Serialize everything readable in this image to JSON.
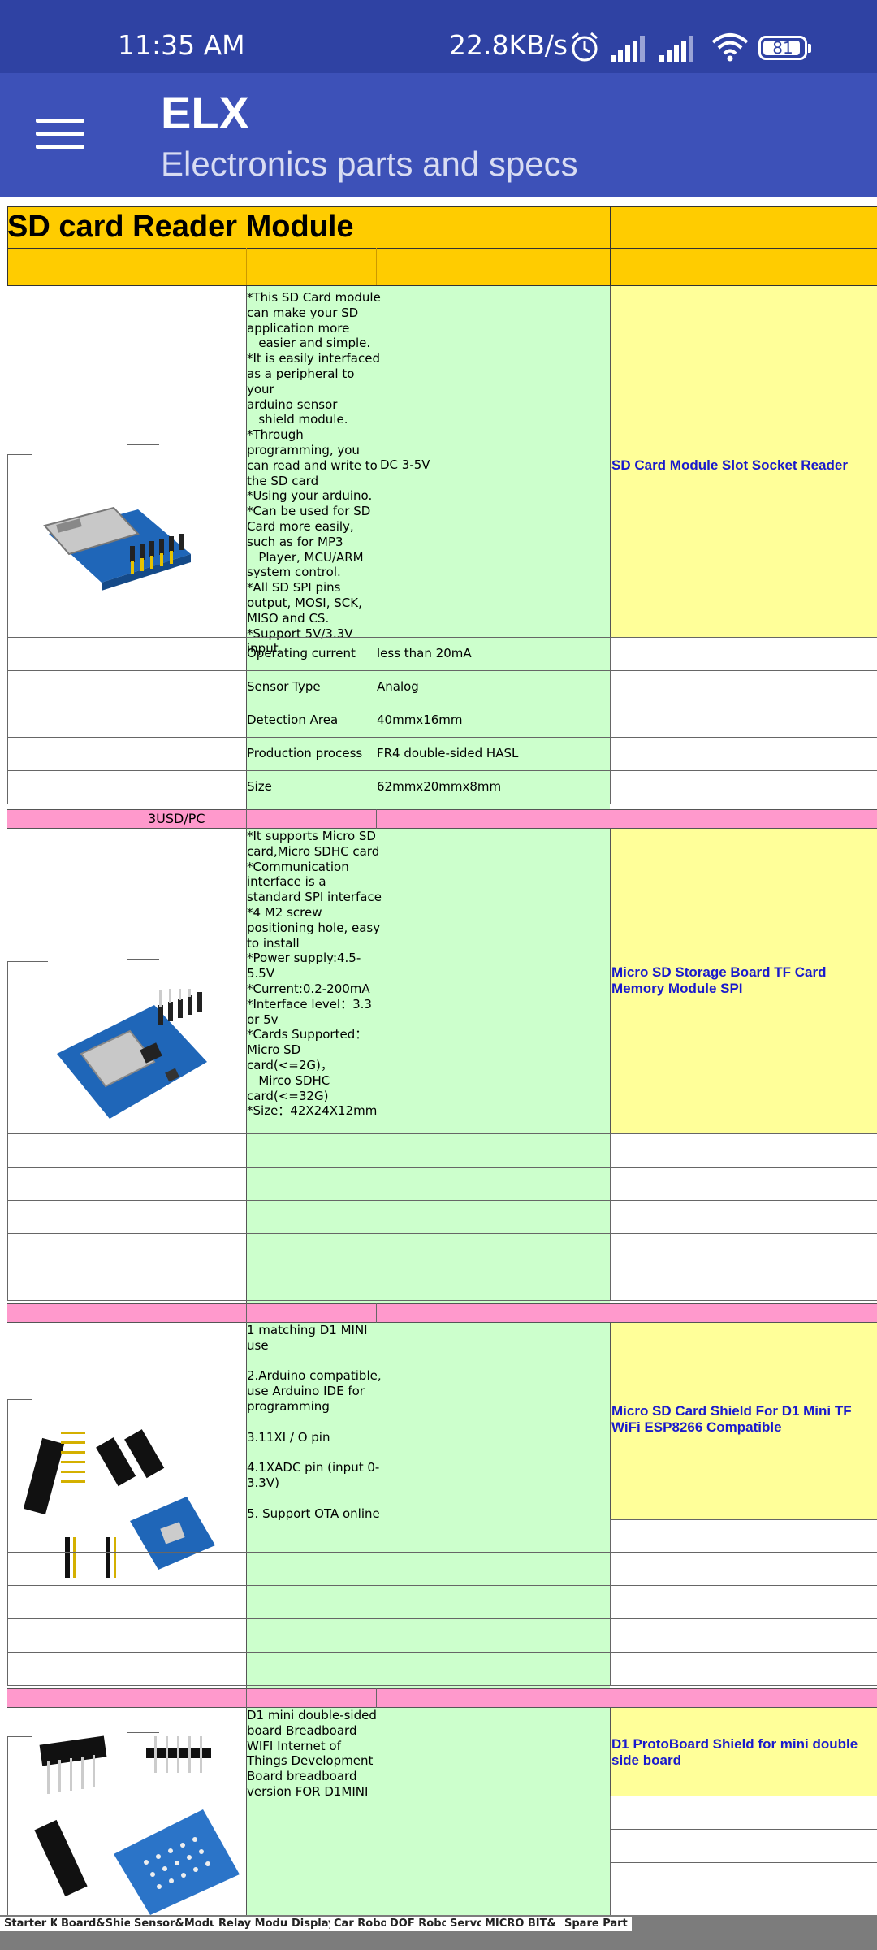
{
  "status_bar": {
    "time": "11:35 AM",
    "network_speed": "22.8KB/s",
    "battery": "81",
    "icons": [
      "alarm-icon",
      "signal-icon",
      "signal-icon",
      "wifi-icon",
      "battery-icon"
    ]
  },
  "app_bar": {
    "title": "ELX",
    "subtitle": "Electronics parts and specs",
    "menu_icon": "hamburger-menu-icon"
  },
  "sheet": {
    "section_title": "SD card Reader Module",
    "products": [
      {
        "description": "*This SD Card module\ncan make your SD\napplication more\n   easier and simple.\n*It is easily interfaced\nas a peripheral to your\narduino sensor\n   shield module.\n*Through\nprogramming, you\ncan read and write to\nthe SD card\n*Using your arduino.\n*Can be used for SD\nCard more easily,\nsuch as for MP3\n   Player, MCU/ARM\nsystem control.\n*All SD SPI pins\noutput, MOSI, SCK,\nMISO and CS.\n*Support 5V/3.3V\ninput",
        "voltage": "DC 3-5V",
        "name": "SD Card Module Slot Socket Reader",
        "specs": [
          {
            "label": "Operating current",
            "value": "less than 20mA"
          },
          {
            "label": "Sensor Type",
            "value": "Analog"
          },
          {
            "label": "Detection Area",
            "value": "40mmx16mm"
          },
          {
            "label": "Production process",
            "value": "FR4 double-sided HASL"
          },
          {
            "label": "Size",
            "value": "62mmx20mmx8mm"
          }
        ],
        "price": "3USD/PC"
      },
      {
        "description": "*It supports Micro SD\ncard,Micro SDHC card\n*Communication\ninterface is a\nstandard SPI interface\n*4 M2 screw\npositioning hole, easy\nto install\n*Power supply:4.5-\n5.5V\n*Current:0.2-200mA\n*Interface level：3.3\nor 5v\n*Cards Supported：\nMicro SD\ncard(<=2G)，\n   Mirco SDHC\ncard(<=32G)\n*Size：42X24X12mm",
        "name": "Micro SD Storage Board TF Card Memory Module SPI"
      },
      {
        "description": "1 matching D1 MINI\nuse\n\n2.Arduino compatible,\nuse Arduino IDE for\nprogramming\n\n3.11XI / O pin\n\n4.1XADC pin (input 0-\n3.3V)\n\n5. Support OTA online",
        "name": "Micro SD Card Shield For D1 Mini TF WiFi ESP8266 Compatible"
      },
      {
        "description": "D1 mini double-sided\nboard Breadboard\nWIFI Internet of\nThings Development\nBoard breadboard\nversion FOR D1MINI",
        "name": "D1 ProtoBoard Shield for mini double side board"
      }
    ]
  },
  "sheet_tabs": [
    "Starter Kit",
    "Board&Shield",
    "Sensor&Module",
    "Relay Module",
    "Display",
    "Car Robot",
    "DOF Robot",
    "Servo",
    "MICRO BIT& PI",
    "Spare Part"
  ]
}
